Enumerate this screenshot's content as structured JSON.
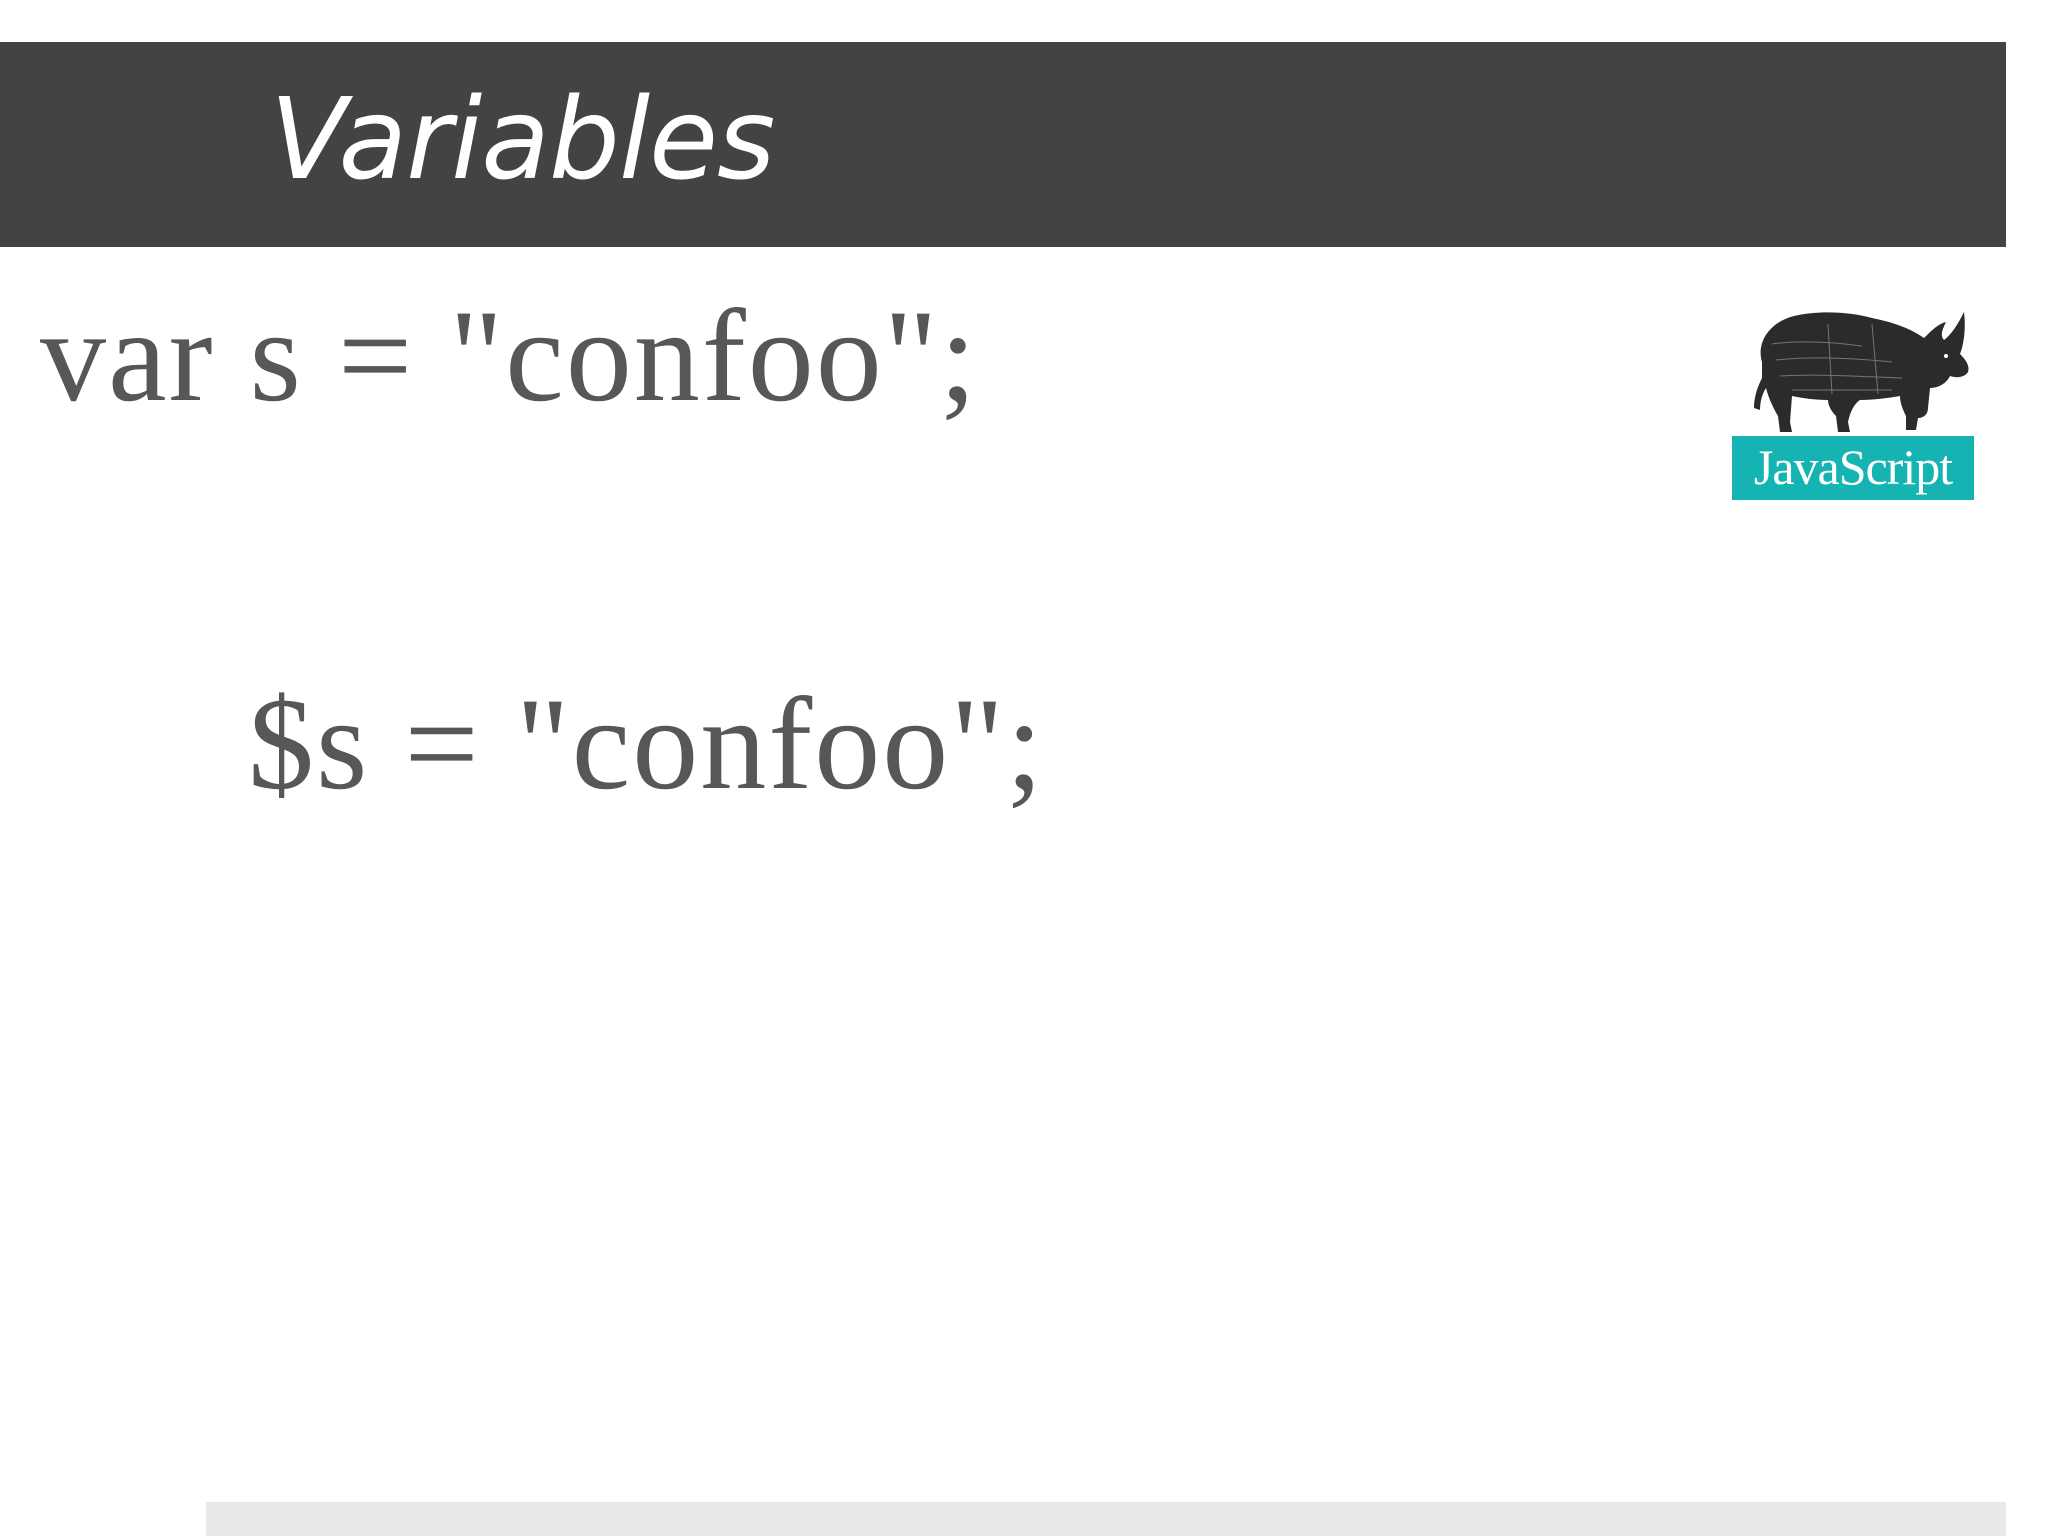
{
  "slide": {
    "title": "Variables",
    "code": {
      "javascript_line": "var s = \"confoo\";",
      "php_line": "$s = \"confoo\";"
    },
    "logo": {
      "icon": "rhino-icon",
      "text": "JavaScript"
    }
  },
  "colors": {
    "title_bar": "#434343",
    "title_text": "#ffffff",
    "code_text": "#575757",
    "logo_band": "#16b3b3",
    "footer_bar": "#e8e8e6"
  }
}
